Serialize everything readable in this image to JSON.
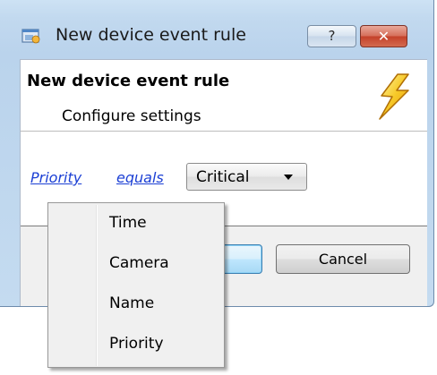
{
  "window": {
    "title": "New device event rule",
    "help_label": "?",
    "close_label": "✕"
  },
  "header": {
    "title": "New device event rule",
    "subtitle": "Configure settings",
    "icon": "lightning-icon"
  },
  "rule": {
    "field_link": "Priority",
    "operator_link": "equals",
    "value_selected": "Critical"
  },
  "buttons": {
    "ok_label": "",
    "cancel_label": "Cancel"
  },
  "dropdown": {
    "items": [
      {
        "label": "Time"
      },
      {
        "label": "Camera"
      },
      {
        "label": "Name"
      },
      {
        "label": "Priority"
      }
    ]
  },
  "colors": {
    "link": "#1b3fd4",
    "close_button": "#c4412a",
    "accent_button": "#bee6fd"
  }
}
